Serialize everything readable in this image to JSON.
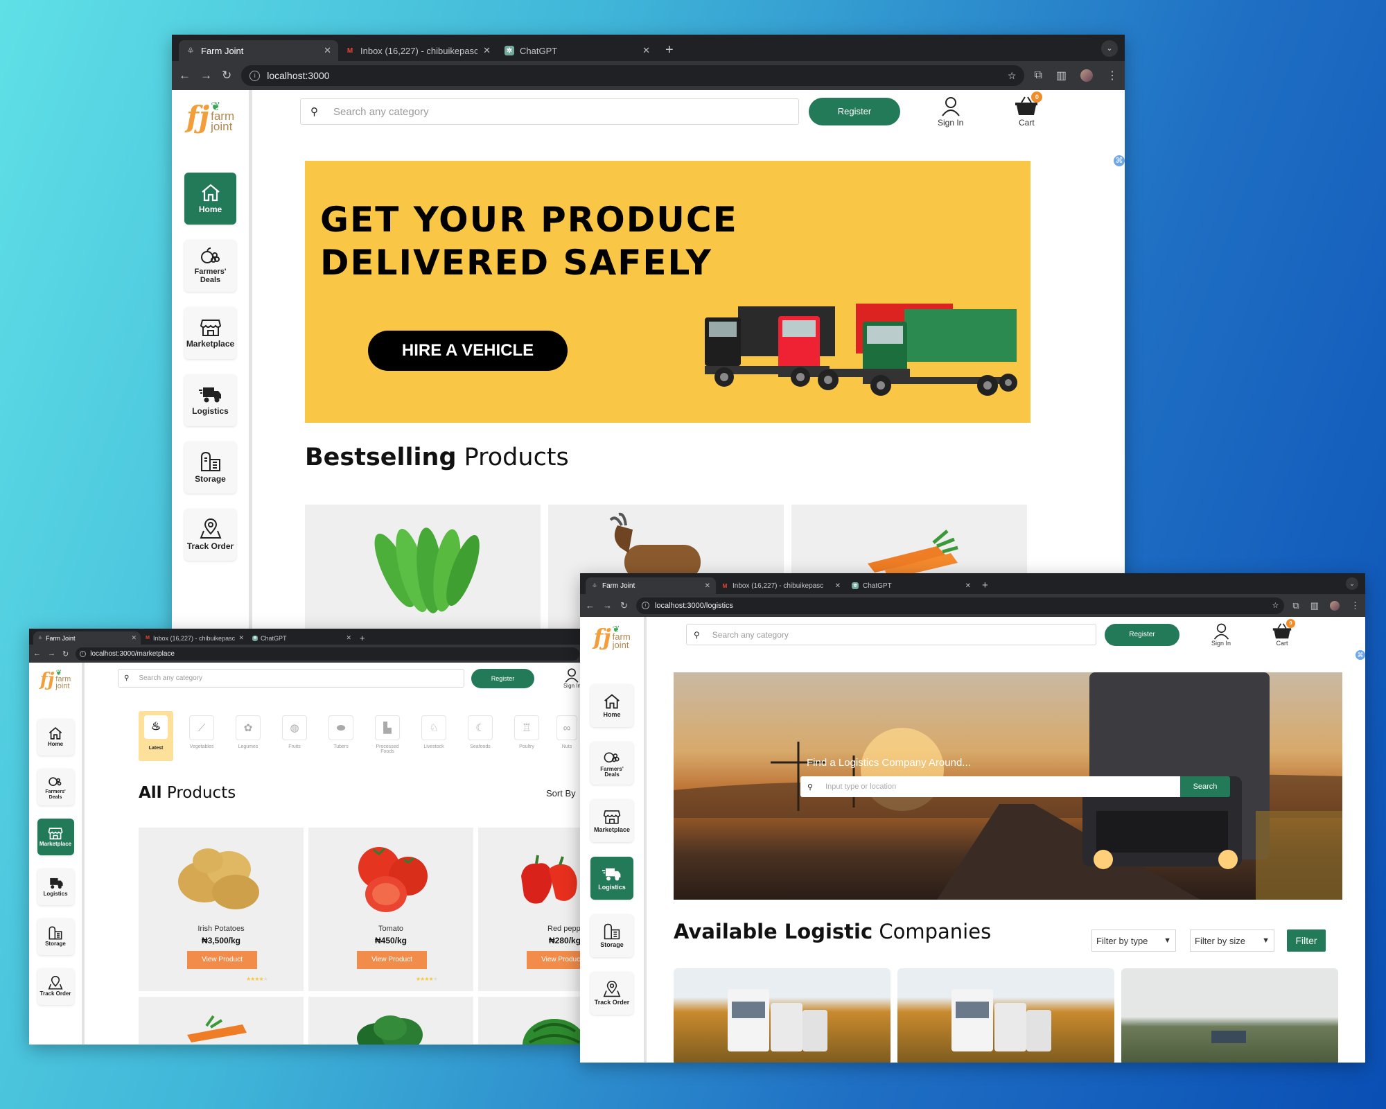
{
  "brand": {
    "mark": "fj",
    "line1": "farm",
    "line2": "joint"
  },
  "tabs": [
    {
      "title": "Farm Joint"
    },
    {
      "title": "Inbox (16,227) - chibuikepasc"
    },
    {
      "title": "ChatGPT"
    }
  ],
  "nav": {
    "home": "Home",
    "farmers_deals": "Farmers' Deals",
    "marketplace": "Marketplace",
    "logistics": "Logistics",
    "storage": "Storage",
    "track_order": "Track Order"
  },
  "header": {
    "search_placeholder": "Search any category",
    "register": "Register",
    "sign_in": "Sign In",
    "cart": "Cart",
    "cart_count": "0"
  },
  "home": {
    "url": "localhost:3000",
    "banner_line1": "GET YOUR PRODUCE",
    "banner_line2": "DELIVERED SAFELY",
    "banner_cta": "HIRE A VEHICLE",
    "section_bold": "Bestselling",
    "section_rest": " Products"
  },
  "marketplace": {
    "url": "localhost:3000/marketplace",
    "categories": [
      "Latest",
      "Vegetables",
      "Legumes",
      "Fruits",
      "Tubers",
      "Processed Foods",
      "Livestock",
      "Seafoods",
      "Poultry",
      "Nuts"
    ],
    "heading_bold": "All",
    "heading_rest": " Products",
    "sort_label": "Sort By",
    "products": [
      {
        "name": "Irish Potatoes",
        "price": "₦3,500/kg",
        "cta": "View Product"
      },
      {
        "name": "Tomato",
        "price": "₦450/kg",
        "cta": "View Product"
      },
      {
        "name": "Red pepper",
        "price": "₦280/kg",
        "cta": "View Product"
      }
    ]
  },
  "logistics": {
    "url": "localhost:3000/logistics",
    "hero_text": "Find a Logistics Company Around...",
    "hero_placeholder": "Input type or location",
    "hero_button": "Search",
    "heading_bold": "Available Logistic",
    "heading_rest": " Companies",
    "filter_type": "Filter by type",
    "filter_size": "Filter by size",
    "filter_button": "Filter"
  },
  "colors": {
    "green": "#237a59",
    "orange": "#f28c4a",
    "banner": "#f9c646"
  }
}
